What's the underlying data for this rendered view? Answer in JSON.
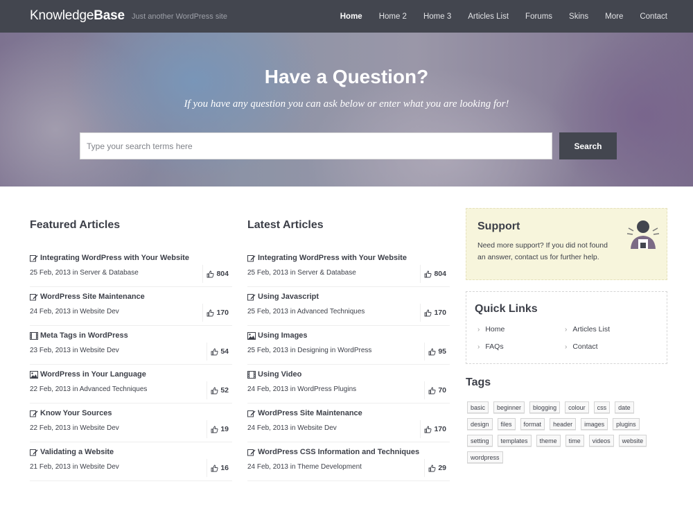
{
  "header": {
    "logo_light": "Knowledge",
    "logo_bold": "Base",
    "tagline": "Just another WordPress site",
    "nav": [
      {
        "label": "Home",
        "active": true
      },
      {
        "label": "Home 2"
      },
      {
        "label": "Home 3"
      },
      {
        "label": "Articles List"
      },
      {
        "label": "Forums"
      },
      {
        "label": "Skins"
      },
      {
        "label": "More"
      },
      {
        "label": "Contact"
      }
    ]
  },
  "hero": {
    "title": "Have a Question?",
    "subtitle": "If you have any question you can ask below or enter what you are looking for!",
    "search_placeholder": "Type your search terms here",
    "search_button": "Search"
  },
  "featured": {
    "title": "Featured Articles",
    "articles": [
      {
        "title": "Integrating WordPress with Your Website",
        "date": "25 Feb, 2013",
        "in": "in",
        "category": "Server & Database",
        "likes": "804",
        "icon": "edit-icon"
      },
      {
        "title": "WordPress Site Maintenance",
        "date": "24 Feb, 2013",
        "in": "in",
        "category": "Website Dev",
        "likes": "170",
        "icon": "edit-icon"
      },
      {
        "title": "Meta Tags in WordPress",
        "date": "23 Feb, 2013",
        "in": "in",
        "category": "Website Dev",
        "likes": "54",
        "icon": "film-icon"
      },
      {
        "title": "WordPress in Your Language",
        "date": "22 Feb, 2013",
        "in": "in",
        "category": "Advanced Techniques",
        "likes": "52",
        "icon": "image-icon"
      },
      {
        "title": "Know Your Sources",
        "date": "22 Feb, 2013",
        "in": "in",
        "category": "Website Dev",
        "likes": "19",
        "icon": "edit-icon"
      },
      {
        "title": "Validating a Website",
        "date": "21 Feb, 2013",
        "in": "in",
        "category": "Website Dev",
        "likes": "16",
        "icon": "edit-icon"
      }
    ]
  },
  "latest": {
    "title": "Latest Articles",
    "articles": [
      {
        "title": "Integrating WordPress with Your Website",
        "date": "25 Feb, 2013",
        "in": "in",
        "category": "Server & Database",
        "likes": "804",
        "icon": "edit-icon"
      },
      {
        "title": "Using Javascript",
        "date": "25 Feb, 2013",
        "in": "in",
        "category": "Advanced Techniques",
        "likes": "170",
        "icon": "edit-icon"
      },
      {
        "title": "Using Images",
        "date": "25 Feb, 2013",
        "in": "in",
        "category": "Designing in WordPress",
        "likes": "95",
        "icon": "image-icon"
      },
      {
        "title": "Using Video",
        "date": "24 Feb, 2013",
        "in": "in",
        "category": "WordPress Plugins",
        "likes": "70",
        "icon": "film-icon"
      },
      {
        "title": "WordPress Site Maintenance",
        "date": "24 Feb, 2013",
        "in": "in",
        "category": "Website Dev",
        "likes": "170",
        "icon": "edit-icon"
      },
      {
        "title": "WordPress CSS Information and Techniques",
        "date": "24 Feb, 2013",
        "in": "in",
        "category": "Theme Development",
        "likes": "29",
        "icon": "edit-icon"
      }
    ]
  },
  "support": {
    "title": "Support",
    "text": "Need more support? If you did not found an answer, contact us for further help."
  },
  "quick_links": {
    "title": "Quick Links",
    "links": [
      "Home",
      "Articles List",
      "FAQs",
      "Contact"
    ]
  },
  "tags": {
    "title": "Tags",
    "items": [
      "basic",
      "beginner",
      "blogging",
      "colour",
      "css",
      "date",
      "design",
      "files",
      "format",
      "header",
      "images",
      "plugins",
      "setting",
      "templates",
      "theme",
      "time",
      "videos",
      "website",
      "wordpress"
    ]
  },
  "colors": {
    "header_bg": "#43464f",
    "support_bg": "#f7f5dc",
    "text": "#3c3f48"
  }
}
